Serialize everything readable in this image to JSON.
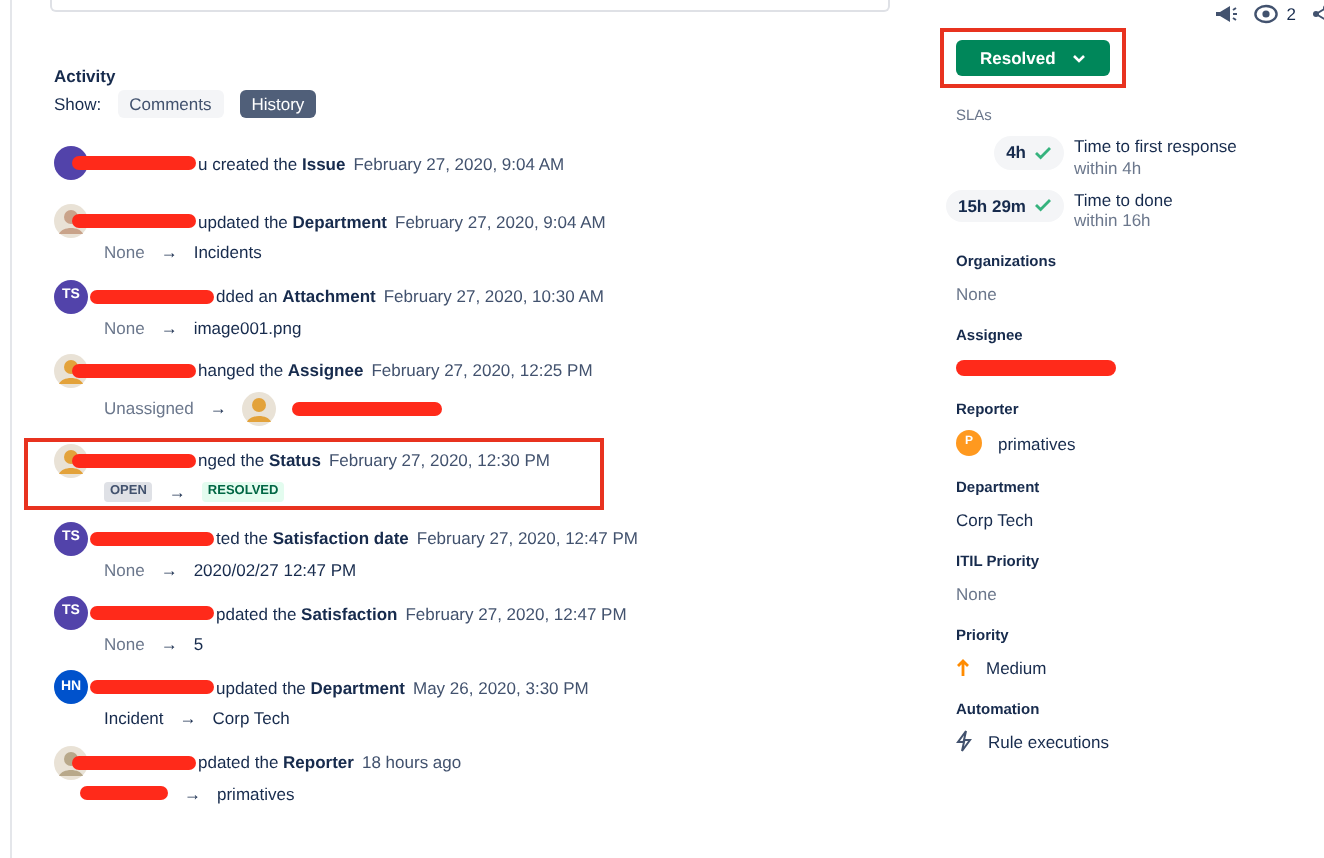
{
  "top_bar": {
    "watchers": "2"
  },
  "change_arrow": "→",
  "activity": {
    "title": "Activity",
    "show_label": "Show:",
    "filters": [
      {
        "label": "Comments",
        "selected": false
      },
      {
        "label": "History",
        "selected": true
      }
    ],
    "entries": [
      {
        "avatar": {
          "kind": "plain",
          "color": "#5243aa"
        },
        "action": "u created the **Issue**",
        "time": "February 27, 2020, 9:04 AM",
        "highlighted": false
      },
      {
        "avatar": {
          "kind": "photo",
          "color": "#c9a38a"
        },
        "action": "updated the **Department**",
        "time": "February 27, 2020, 9:04 AM",
        "highlighted": false,
        "change": {
          "from": {
            "kind": "text",
            "text": "None",
            "muted": true
          },
          "to": {
            "kind": "text",
            "text": "Incidents",
            "muted": false
          }
        }
      },
      {
        "avatar": {
          "kind": "initials",
          "initials": "TS",
          "color": "#5243aa"
        },
        "action": "dded an **Attachment**",
        "time": "February 27, 2020, 10:30 AM",
        "highlighted": false,
        "change": {
          "from": {
            "kind": "text",
            "text": "None",
            "muted": true
          },
          "to": {
            "kind": "text",
            "text": "image001.png",
            "muted": false
          }
        }
      },
      {
        "avatar": {
          "kind": "photo",
          "color": "#e3a23a"
        },
        "action": "hanged the **Assignee**",
        "time": "February 27, 2020, 12:25 PM",
        "highlighted": false,
        "change": {
          "from": {
            "kind": "text",
            "text": "Unassigned",
            "muted": true
          },
          "to": {
            "kind": "user",
            "color": "#e3a23a"
          }
        }
      },
      {
        "avatar": {
          "kind": "photo",
          "color": "#e3a23a"
        },
        "action": "nged the **Status**",
        "time": "February 27, 2020, 12:30 PM",
        "highlighted": true,
        "change": {
          "from": {
            "kind": "lozenge",
            "text": "OPEN",
            "color": "#42526e"
          },
          "to": {
            "kind": "lozenge",
            "text": "RESOLVED",
            "color": "#006644"
          }
        }
      },
      {
        "avatar": {
          "kind": "initials",
          "initials": "TS",
          "color": "#5243aa"
        },
        "action": "ted the **Satisfaction date**",
        "time": "February 27, 2020, 12:47 PM",
        "highlighted": false,
        "change": {
          "from": {
            "kind": "text",
            "text": "None",
            "muted": true
          },
          "to": {
            "kind": "text",
            "text": "2020/02/27 12:47 PM",
            "muted": false
          }
        }
      },
      {
        "avatar": {
          "kind": "initials",
          "initials": "TS",
          "color": "#5243aa"
        },
        "action": "pdated the **Satisfaction**",
        "time": "February 27, 2020, 12:47 PM",
        "highlighted": false,
        "change": {
          "from": {
            "kind": "text",
            "text": "None",
            "muted": true
          },
          "to": {
            "kind": "text",
            "text": "5",
            "muted": false
          }
        }
      },
      {
        "avatar": {
          "kind": "initials",
          "initials": "HN",
          "color": "#0052cc"
        },
        "action": "updated the **Department**",
        "time": "May 26, 2020, 3:30 PM",
        "highlighted": false,
        "change": {
          "from": {
            "kind": "text",
            "text": "Incident",
            "muted": false
          },
          "to": {
            "kind": "text",
            "text": "Corp Tech",
            "muted": false
          }
        }
      },
      {
        "avatar": {
          "kind": "photo",
          "color": "#b8a88a"
        },
        "action": "pdated the **Reporter**",
        "time": "18 hours ago",
        "highlighted": false,
        "change": {
          "from": {
            "kind": "redacted"
          },
          "to": {
            "kind": "text",
            "text": "primatives",
            "muted": false
          }
        }
      }
    ]
  },
  "details": {
    "status_button": {
      "label": "Resolved",
      "highlighted": true
    },
    "slas_label": "SLAs",
    "slas": [
      {
        "time": "4h",
        "name": "Time to first response",
        "target": "within 4h"
      },
      {
        "time": "15h 29m",
        "name": "Time to done",
        "target": "within 16h"
      }
    ],
    "fields": [
      {
        "label": "Organizations",
        "kind": "text",
        "value": "None",
        "muted": true
      },
      {
        "label": "Assignee",
        "kind": "redacted-user"
      },
      {
        "label": "Reporter",
        "kind": "user",
        "value": "primatives",
        "initial": "P",
        "color": "#ff991f"
      },
      {
        "label": "Department",
        "kind": "text",
        "value": "Corp Tech",
        "muted": false
      },
      {
        "label": "ITIL Priority",
        "kind": "text",
        "value": "None",
        "muted": true
      },
      {
        "label": "Priority",
        "kind": "priority",
        "value": "Medium"
      },
      {
        "label": "Automation",
        "kind": "automation",
        "value": "Rule executions"
      }
    ]
  }
}
